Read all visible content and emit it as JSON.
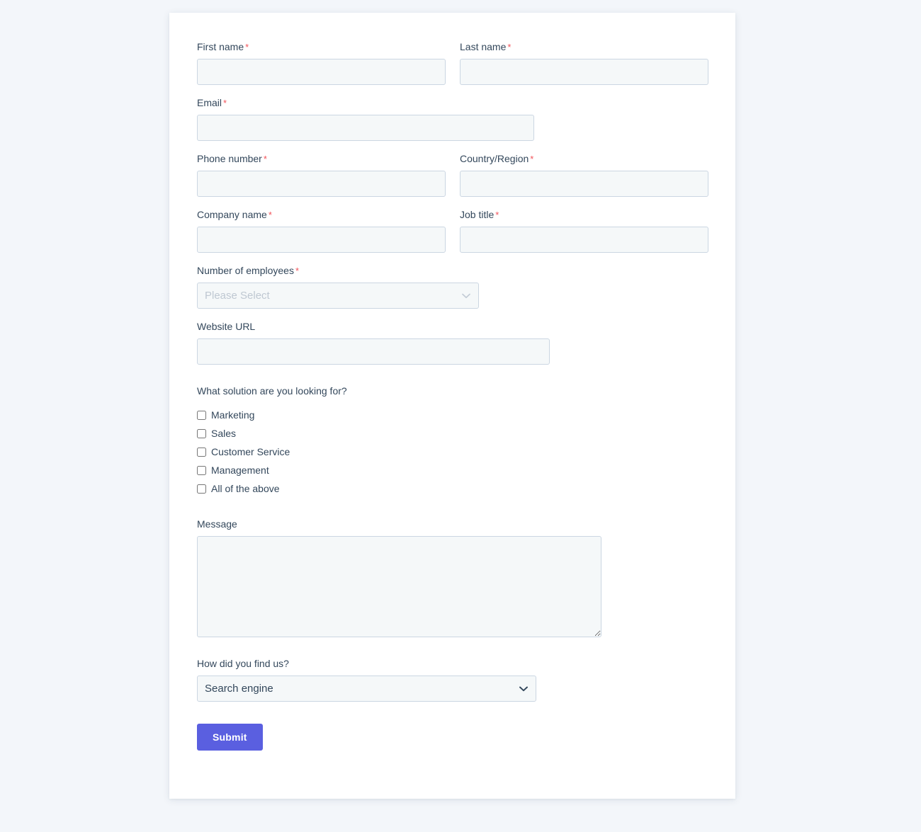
{
  "theme": {
    "page_background": "#f3f6fa",
    "card_background": "#ffffff",
    "label_color": "#33475b",
    "input_background": "#f5f8f9",
    "input_border": "#cbd6e2",
    "required_marker_color": "#f2545b",
    "submit_button_background": "#5a5fe0",
    "submit_button_text_color": "#ffffff",
    "placeholder_color": "#bfc8d2"
  },
  "form": {
    "required_marker": "*",
    "fields": {
      "first_name": {
        "label": "First name",
        "required": true,
        "value": "",
        "placeholder": ""
      },
      "last_name": {
        "label": "Last name",
        "required": true,
        "value": "",
        "placeholder": ""
      },
      "email": {
        "label": "Email",
        "required": true,
        "value": "",
        "placeholder": ""
      },
      "phone_number": {
        "label": "Phone number",
        "required": true,
        "value": "",
        "placeholder": ""
      },
      "country_region": {
        "label": "Country/Region",
        "required": true,
        "value": "",
        "placeholder": ""
      },
      "company_name": {
        "label": "Company name",
        "required": true,
        "value": "",
        "placeholder": ""
      },
      "job_title": {
        "label": "Job title",
        "required": true,
        "value": "",
        "placeholder": ""
      },
      "number_of_employees": {
        "label": "Number of employees",
        "required": true,
        "selected": "Please Select",
        "is_placeholder_selected": true,
        "options": [
          "Please Select"
        ]
      },
      "website_url": {
        "label": "Website URL",
        "required": false,
        "value": "",
        "placeholder": ""
      },
      "solution": {
        "label": "What solution are you looking for?",
        "required": false,
        "options": [
          {
            "label": "Marketing",
            "checked": false
          },
          {
            "label": "Sales",
            "checked": false
          },
          {
            "label": "Customer Service",
            "checked": false
          },
          {
            "label": "Management",
            "checked": false
          },
          {
            "label": "All of the above",
            "checked": false
          }
        ]
      },
      "message": {
        "label": "Message",
        "required": false,
        "value": "",
        "placeholder": ""
      },
      "how_did_you_find_us": {
        "label": "How did you find us?",
        "required": false,
        "selected": "Search engine",
        "is_placeholder_selected": false,
        "options": [
          "Search engine"
        ]
      }
    },
    "submit_label": "Submit"
  }
}
